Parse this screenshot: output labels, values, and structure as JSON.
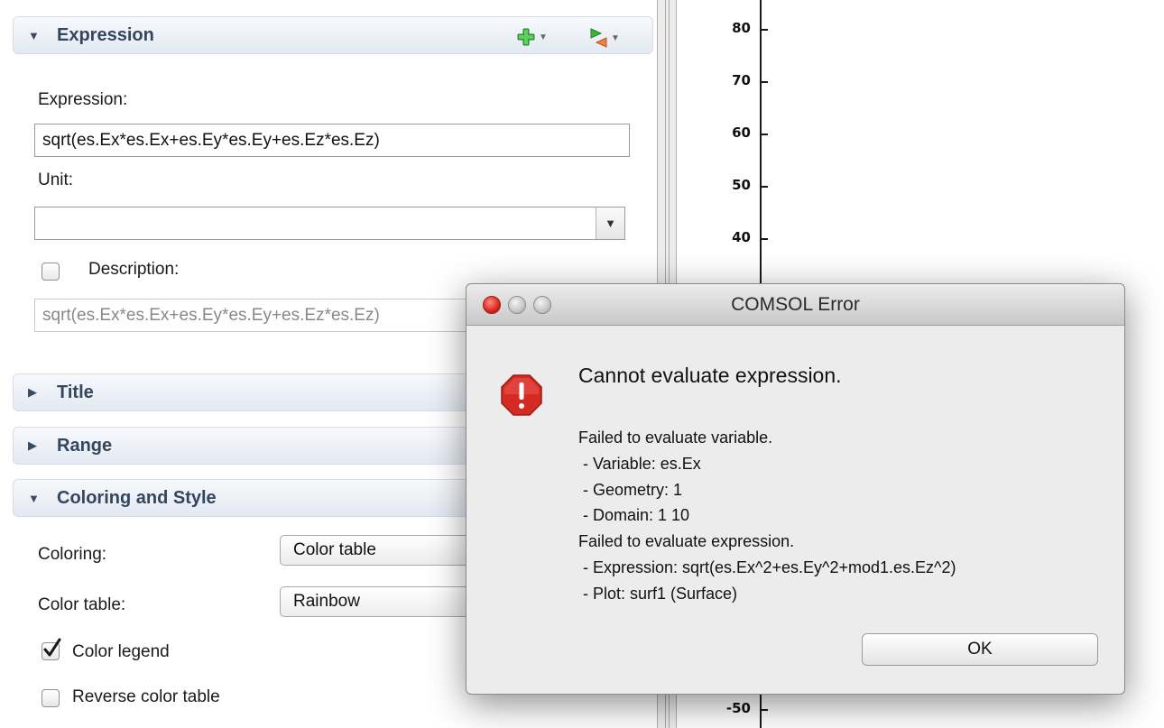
{
  "panel": {
    "expression_section": {
      "title": "Expression",
      "expression_label": "Expression:",
      "expression_value": "sqrt(es.Ex*es.Ex+es.Ey*es.Ey+es.Ez*es.Ez)",
      "unit_label": "Unit:",
      "unit_value": "",
      "description_label": "Description:",
      "description_checked": false,
      "description_value": "sqrt(es.Ex*es.Ex+es.Ey*es.Ey+es.Ez*es.Ez)"
    },
    "title_section": {
      "title": "Title"
    },
    "range_section": {
      "title": "Range"
    },
    "coloring_section": {
      "title": "Coloring and Style",
      "coloring_label": "Coloring:",
      "coloring_value": "Color table",
      "color_table_label": "Color table:",
      "color_table_value": "Rainbow",
      "color_legend_label": "Color legend",
      "color_legend_checked": true,
      "reverse_label": "Reverse color table",
      "reverse_checked": false
    },
    "toolbar_icons": [
      "add-icon",
      "replace-expression-icon"
    ]
  },
  "graphics": {
    "axis_ticks": [
      "80",
      "70",
      "60",
      "50",
      "40",
      "-50"
    ]
  },
  "dialog": {
    "title": "COMSOL Error",
    "heading": "Cannot evaluate expression.",
    "details": [
      "Failed to evaluate variable.",
      " - Variable: es.Ex",
      " - Geometry: 1",
      " - Domain: 1 10",
      "Failed to evaluate expression.",
      " - Expression: sqrt(es.Ex^2+es.Ey^2+mod1.es.Ez^2)",
      " - Plot: surf1 (Surface)"
    ],
    "ok_label": "OK"
  },
  "colors": {
    "section_header_text": "#34465e",
    "error_red": "#d42a22",
    "add_green": "#3cb43c"
  }
}
